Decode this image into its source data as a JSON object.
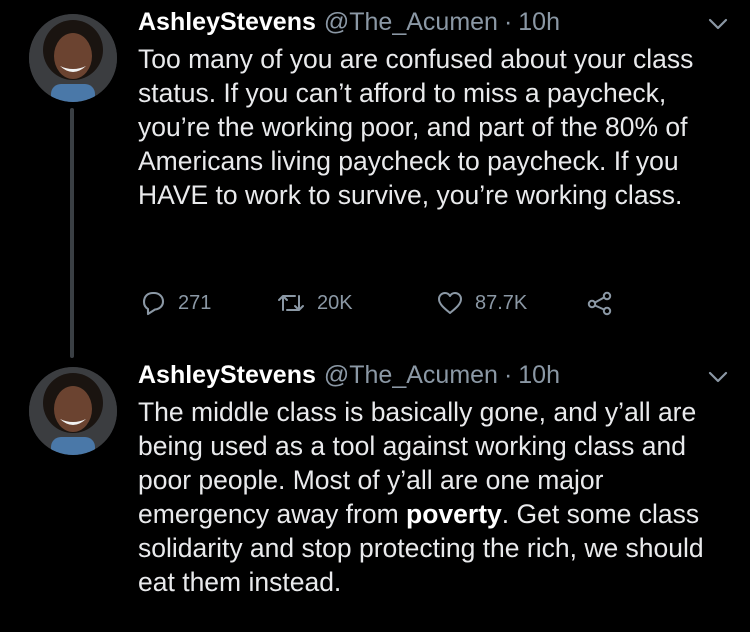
{
  "tweets": [
    {
      "author_name": "AshleyStevens",
      "handle": "@The_Acumen",
      "separator": "·",
      "time": "10h",
      "text": "Too many of you are confused about your class status. If you can’t afford to miss a paycheck, you’re the working poor, and part of the 80% of Americans living paycheck to paycheck. If you HAVE to work to survive, you’re working class.",
      "replies": "271",
      "retweets": "20K",
      "likes": "87.7K"
    },
    {
      "author_name": "AshleyStevens",
      "handle": "@The_Acumen",
      "separator": "·",
      "time": "10h",
      "text_before_bold": "The middle class is basically gone, and y’all are being used as a tool against working class and poor people. Most of y’all are one major emergency away from ",
      "text_bold": "poverty",
      "text_after_bold": ". Get some class solidarity and stop protecting the rich, we should eat them instead."
    }
  ],
  "colors": {
    "background": "#000000",
    "text": "#e9eaec",
    "secondary": "#8b98a5",
    "thread_line": "#3a3f44"
  },
  "icons": [
    "avatar-photo",
    "chevron-down-icon",
    "reply-icon",
    "retweet-icon",
    "like-icon",
    "share-icon"
  ]
}
